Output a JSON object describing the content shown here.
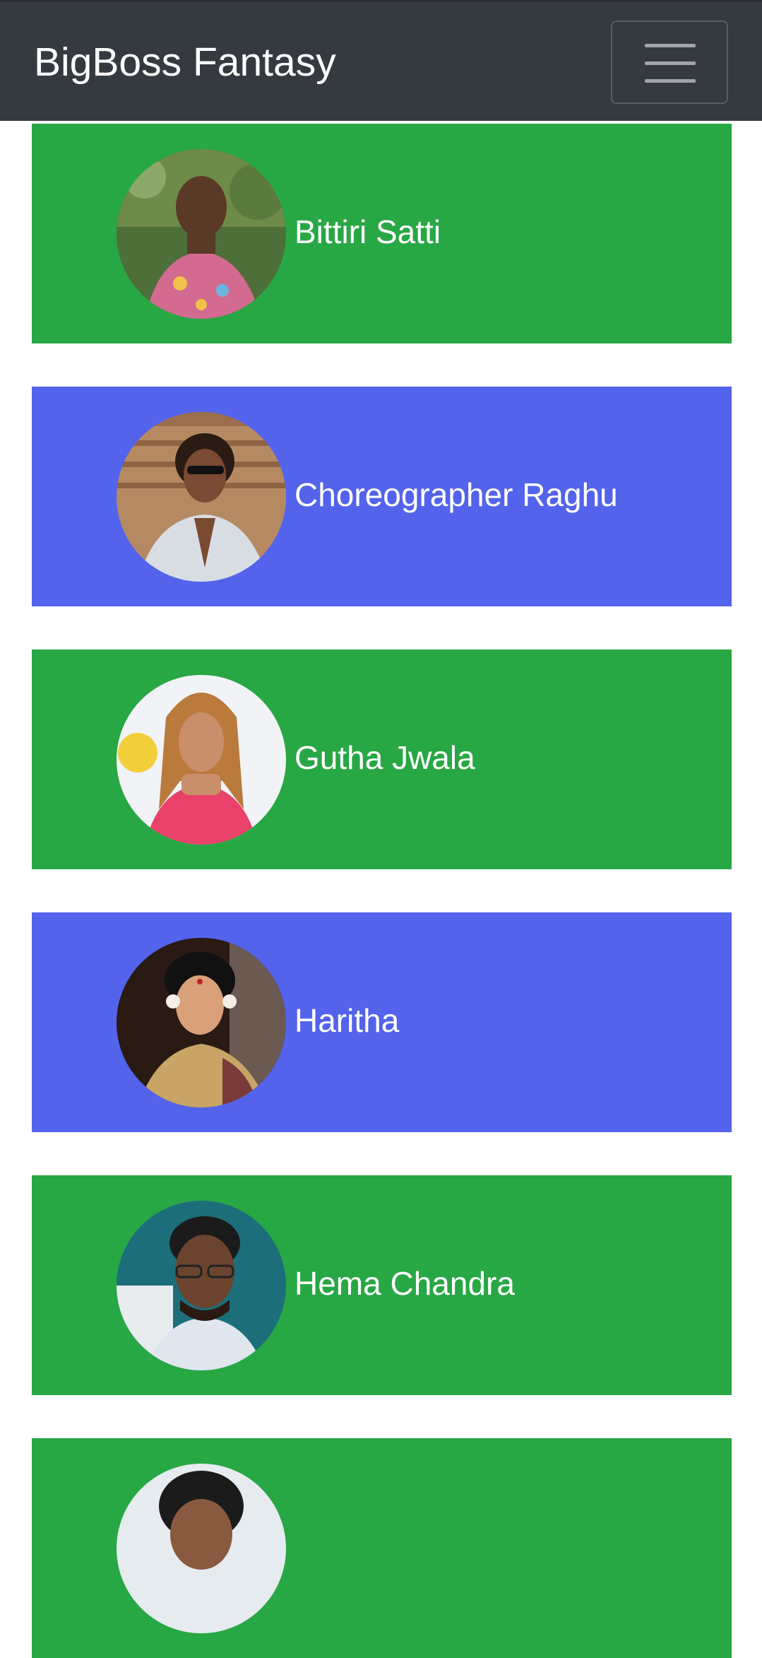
{
  "app": {
    "title": "BigBoss Fantasy"
  },
  "navbar": {
    "toggle_icon": "hamburger-menu-icon",
    "background": "#343a40"
  },
  "theme": {
    "green": "#28a745",
    "blue": "#5363eb"
  },
  "contestants": [
    {
      "name": "Bittiri Satti",
      "color": "#28a745",
      "avatar": "contestant-photo"
    },
    {
      "name": "Choreographer Raghu",
      "color": "#5363eb",
      "avatar": "contestant-photo"
    },
    {
      "name": "Gutha Jwala",
      "color": "#28a745",
      "avatar": "contestant-photo"
    },
    {
      "name": "Haritha",
      "color": "#5363eb",
      "avatar": "contestant-photo"
    },
    {
      "name": "Hema Chandra",
      "color": "#28a745",
      "avatar": "contestant-photo"
    },
    {
      "name": "",
      "color": "#28a745",
      "avatar": "contestant-photo"
    }
  ]
}
